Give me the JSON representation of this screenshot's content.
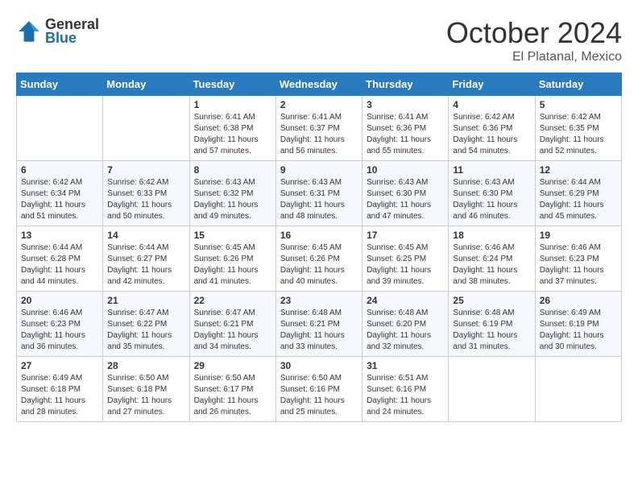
{
  "header": {
    "logo_general": "General",
    "logo_blue": "Blue",
    "month": "October 2024",
    "location": "El Platanal, Mexico"
  },
  "weekdays": [
    "Sunday",
    "Monday",
    "Tuesday",
    "Wednesday",
    "Thursday",
    "Friday",
    "Saturday"
  ],
  "weeks": [
    [
      {
        "day": "",
        "info": ""
      },
      {
        "day": "",
        "info": ""
      },
      {
        "day": "1",
        "info": "Sunrise: 6:41 AM\nSunset: 6:38 PM\nDaylight: 11 hours and 57 minutes."
      },
      {
        "day": "2",
        "info": "Sunrise: 6:41 AM\nSunset: 6:37 PM\nDaylight: 11 hours and 56 minutes."
      },
      {
        "day": "3",
        "info": "Sunrise: 6:41 AM\nSunset: 6:36 PM\nDaylight: 11 hours and 55 minutes."
      },
      {
        "day": "4",
        "info": "Sunrise: 6:42 AM\nSunset: 6:36 PM\nDaylight: 11 hours and 54 minutes."
      },
      {
        "day": "5",
        "info": "Sunrise: 6:42 AM\nSunset: 6:35 PM\nDaylight: 11 hours and 52 minutes."
      }
    ],
    [
      {
        "day": "6",
        "info": "Sunrise: 6:42 AM\nSunset: 6:34 PM\nDaylight: 11 hours and 51 minutes."
      },
      {
        "day": "7",
        "info": "Sunrise: 6:42 AM\nSunset: 6:33 PM\nDaylight: 11 hours and 50 minutes."
      },
      {
        "day": "8",
        "info": "Sunrise: 6:43 AM\nSunset: 6:32 PM\nDaylight: 11 hours and 49 minutes."
      },
      {
        "day": "9",
        "info": "Sunrise: 6:43 AM\nSunset: 6:31 PM\nDaylight: 11 hours and 48 minutes."
      },
      {
        "day": "10",
        "info": "Sunrise: 6:43 AM\nSunset: 6:30 PM\nDaylight: 11 hours and 47 minutes."
      },
      {
        "day": "11",
        "info": "Sunrise: 6:43 AM\nSunset: 6:30 PM\nDaylight: 11 hours and 46 minutes."
      },
      {
        "day": "12",
        "info": "Sunrise: 6:44 AM\nSunset: 6:29 PM\nDaylight: 11 hours and 45 minutes."
      }
    ],
    [
      {
        "day": "13",
        "info": "Sunrise: 6:44 AM\nSunset: 6:28 PM\nDaylight: 11 hours and 44 minutes."
      },
      {
        "day": "14",
        "info": "Sunrise: 6:44 AM\nSunset: 6:27 PM\nDaylight: 11 hours and 42 minutes."
      },
      {
        "day": "15",
        "info": "Sunrise: 6:45 AM\nSunset: 6:26 PM\nDaylight: 11 hours and 41 minutes."
      },
      {
        "day": "16",
        "info": "Sunrise: 6:45 AM\nSunset: 6:26 PM\nDaylight: 11 hours and 40 minutes."
      },
      {
        "day": "17",
        "info": "Sunrise: 6:45 AM\nSunset: 6:25 PM\nDaylight: 11 hours and 39 minutes."
      },
      {
        "day": "18",
        "info": "Sunrise: 6:46 AM\nSunset: 6:24 PM\nDaylight: 11 hours and 38 minutes."
      },
      {
        "day": "19",
        "info": "Sunrise: 6:46 AM\nSunset: 6:23 PM\nDaylight: 11 hours and 37 minutes."
      }
    ],
    [
      {
        "day": "20",
        "info": "Sunrise: 6:46 AM\nSunset: 6:23 PM\nDaylight: 11 hours and 36 minutes."
      },
      {
        "day": "21",
        "info": "Sunrise: 6:47 AM\nSunset: 6:22 PM\nDaylight: 11 hours and 35 minutes."
      },
      {
        "day": "22",
        "info": "Sunrise: 6:47 AM\nSunset: 6:21 PM\nDaylight: 11 hours and 34 minutes."
      },
      {
        "day": "23",
        "info": "Sunrise: 6:48 AM\nSunset: 6:21 PM\nDaylight: 11 hours and 33 minutes."
      },
      {
        "day": "24",
        "info": "Sunrise: 6:48 AM\nSunset: 6:20 PM\nDaylight: 11 hours and 32 minutes."
      },
      {
        "day": "25",
        "info": "Sunrise: 6:48 AM\nSunset: 6:19 PM\nDaylight: 11 hours and 31 minutes."
      },
      {
        "day": "26",
        "info": "Sunrise: 6:49 AM\nSunset: 6:19 PM\nDaylight: 11 hours and 30 minutes."
      }
    ],
    [
      {
        "day": "27",
        "info": "Sunrise: 6:49 AM\nSunset: 6:18 PM\nDaylight: 11 hours and 28 minutes."
      },
      {
        "day": "28",
        "info": "Sunrise: 6:50 AM\nSunset: 6:18 PM\nDaylight: 11 hours and 27 minutes."
      },
      {
        "day": "29",
        "info": "Sunrise: 6:50 AM\nSunset: 6:17 PM\nDaylight: 11 hours and 26 minutes."
      },
      {
        "day": "30",
        "info": "Sunrise: 6:50 AM\nSunset: 6:16 PM\nDaylight: 11 hours and 25 minutes."
      },
      {
        "day": "31",
        "info": "Sunrise: 6:51 AM\nSunset: 6:16 PM\nDaylight: 11 hours and 24 minutes."
      },
      {
        "day": "",
        "info": ""
      },
      {
        "day": "",
        "info": ""
      }
    ]
  ]
}
